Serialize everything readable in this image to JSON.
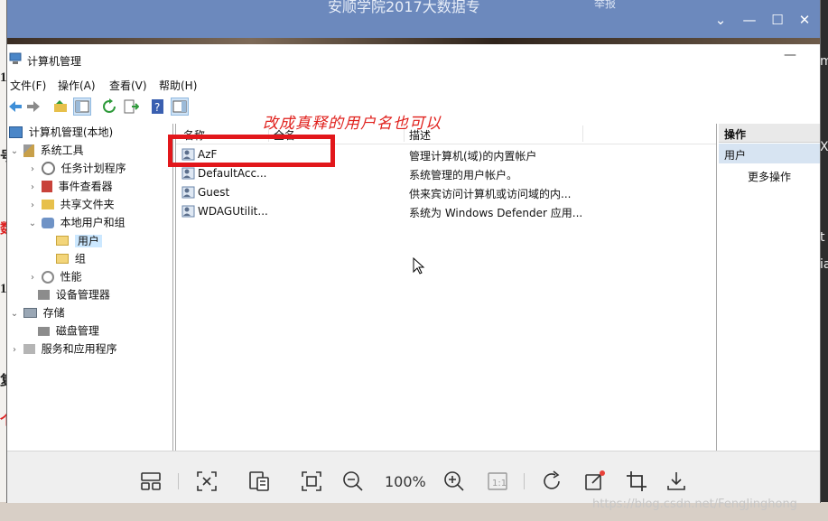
{
  "outer_window": {
    "title": "安顺学院2017大数据专",
    "hint": "举报"
  },
  "window": {
    "title": "计算机管理"
  },
  "menu": [
    "文件(F)",
    "操作(A)",
    "查看(V)",
    "帮助(H)"
  ],
  "tree": {
    "root": "计算机管理(本地)",
    "system_tools": "系统工具",
    "task_scheduler": "任务计划程序",
    "event_viewer": "事件查看器",
    "shared_folders": "共享文件夹",
    "local_users_groups": "本地用户和组",
    "users": "用户",
    "groups": "组",
    "performance": "性能",
    "device_manager": "设备管理器",
    "storage": "存储",
    "disk_management": "磁盘管理",
    "services_apps": "服务和应用程序"
  },
  "list": {
    "columns": [
      "名称",
      "全名",
      "描述"
    ],
    "rows": [
      {
        "name": "AzF",
        "full_name": "",
        "description": "管理计算机(域)的内置帐户"
      },
      {
        "name": "DefaultAcc...",
        "full_name": "",
        "description": "系统管理的用户帐户。"
      },
      {
        "name": "Guest",
        "full_name": "",
        "description": "供来宾访问计算机或访问域的内..."
      },
      {
        "name": "WDAGUtilit...",
        "full_name": "",
        "description": "系统为 Windows Defender 应用..."
      }
    ]
  },
  "actions": {
    "header": "操作",
    "section": "用户",
    "more": "更多操作"
  },
  "annotation": {
    "text": "改成真释的用户名也可以",
    "color": "#e2171b"
  },
  "viewer": {
    "zoom": "100%"
  },
  "watermark": "https://blog.csdn.net/FengJinghong",
  "colors": {
    "title_bar": "#6c89bd",
    "selection": "#cce8ff",
    "annotation": "#e2171b"
  }
}
